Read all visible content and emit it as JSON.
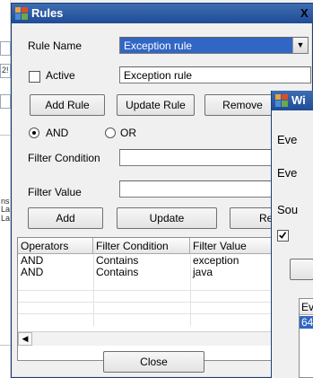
{
  "bg": {
    "texts": [
      "2!",
      "ns",
      "La",
      "La"
    ]
  },
  "dialog": {
    "title": "Rules",
    "close_label": "X",
    "rule_name_label": "Rule Name",
    "rule_name_value": "Exception rule",
    "active_label": "Active",
    "active_value": "Exception rule",
    "buttons": {
      "add_rule": "Add Rule",
      "update_rule": "Update Rule",
      "remove": "Remove",
      "add": "Add",
      "update": "Update",
      "rem": "Ren",
      "close": "Close"
    },
    "and_label": "AND",
    "or_label": "OR",
    "filter_condition_label": "Filter Condition",
    "filter_value_label": "Filter Value",
    "filter_condition_value": "",
    "filter_value_value": ""
  },
  "grid": {
    "headers": [
      "Operators",
      "Filter Condition",
      "Filter Value"
    ],
    "rows": [
      [
        "AND",
        "Contains",
        "exception"
      ],
      [
        "AND",
        "Contains",
        "java"
      ]
    ]
  },
  "win2": {
    "title": "Wi",
    "labels": [
      "Eve",
      "Eve",
      "Sou"
    ],
    "list_header": "Ev",
    "list_item": "64"
  }
}
